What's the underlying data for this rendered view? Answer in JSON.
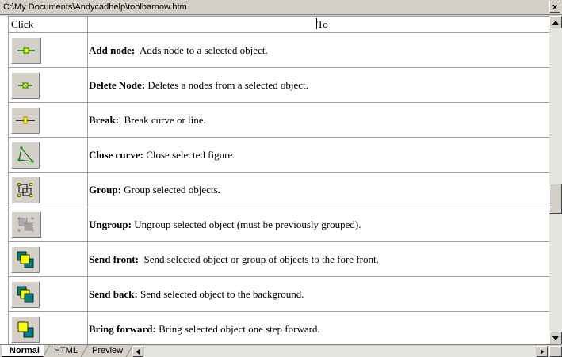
{
  "window": {
    "path": "C:\\My Documents\\Andycadhelp\\toolbarnow.htm",
    "close_glyph": "x"
  },
  "table": {
    "headers": [
      "Click",
      "To"
    ],
    "rows": [
      {
        "icon": "add-node-icon",
        "name": "Add node:",
        "desc": "Adds node to  a selected object."
      },
      {
        "icon": "delete-node-icon",
        "name": "Delete Node:",
        "desc": "Deletes  a nodes from a selected object."
      },
      {
        "icon": "break-icon",
        "name": "Break:",
        "desc": "Break curve or line."
      },
      {
        "icon": "close-curve-icon",
        "name": "Close curve:",
        "desc": "Close selected figure."
      },
      {
        "icon": "group-icon",
        "name": "Group:",
        "desc": "Group selected objects."
      },
      {
        "icon": "ungroup-icon",
        "name": "Ungroup:",
        "desc": "Ungroup selected object (must be previously grouped)."
      },
      {
        "icon": "send-front-icon",
        "name": "Send front:",
        "desc": "Send selected object or group of objects to the fore front."
      },
      {
        "icon": "send-back-icon",
        "name": "Send back:",
        "desc": "Send selected object to the background."
      },
      {
        "icon": "bring-forward-icon",
        "name": "Bring forward:",
        "desc": "Bring selected object one step forward."
      }
    ]
  },
  "view_tabs": [
    "Normal",
    "HTML",
    "Preview"
  ],
  "active_tab": "Normal",
  "colors": {
    "yellow": "#ffff00",
    "teal": "#008080",
    "green": "#00a000",
    "chrome": "#d4d0c8"
  }
}
